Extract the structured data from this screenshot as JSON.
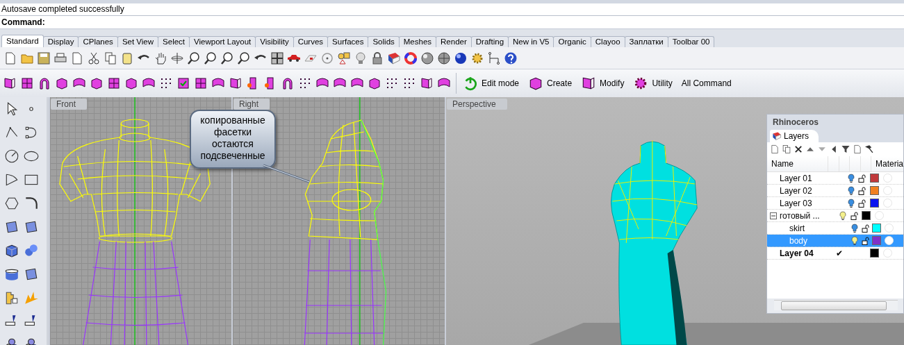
{
  "status": {
    "message": "Autosave completed successfully",
    "command_label": "Command:"
  },
  "tabs": [
    {
      "label": "Standard",
      "selected": true
    },
    {
      "label": "Display",
      "selected": false
    },
    {
      "label": "CPlanes",
      "selected": false
    },
    {
      "label": "Set View",
      "selected": false
    },
    {
      "label": "Select",
      "selected": false
    },
    {
      "label": "Viewport Layout",
      "selected": false
    },
    {
      "label": "Visibility",
      "selected": false
    },
    {
      "label": "Curves",
      "selected": false
    },
    {
      "label": "Surfaces",
      "selected": false
    },
    {
      "label": "Solids",
      "selected": false
    },
    {
      "label": "Meshes",
      "selected": false
    },
    {
      "label": "Render",
      "selected": false
    },
    {
      "label": "Drafting",
      "selected": false
    },
    {
      "label": "New in V5",
      "selected": false
    },
    {
      "label": "Organic",
      "selected": false
    },
    {
      "label": "Clayoo",
      "selected": false
    },
    {
      "label": "Заплатки",
      "selected": false
    },
    {
      "label": "Toolbar 00",
      "selected": false
    }
  ],
  "toolbar_buttons": [
    {
      "label": "Edit mode",
      "kind": "power"
    },
    {
      "label": "Create",
      "kind": "cube"
    },
    {
      "label": "Modify",
      "kind": "surface"
    },
    {
      "label": "Utility",
      "kind": "gear"
    },
    {
      "label": "All Command",
      "kind": "text"
    }
  ],
  "viewports": [
    {
      "title": "Front"
    },
    {
      "title": "Right"
    },
    {
      "title": "Perspective"
    }
  ],
  "callout": {
    "text": "копированные фасетки остаются подсвеченные"
  },
  "layers_panel": {
    "title": "Rhinoceros",
    "tab": "Layers",
    "columns": [
      "Name",
      "Materia"
    ],
    "layers": [
      {
        "name": "Layer 01",
        "kind": "layer",
        "lit": false,
        "locked": false,
        "color": "#c0393b",
        "selected": false
      },
      {
        "name": "Layer 02",
        "kind": "layer",
        "lit": false,
        "locked": false,
        "color": "#f08020",
        "selected": false
      },
      {
        "name": "Layer 03",
        "kind": "layer",
        "lit": false,
        "locked": false,
        "color": "#0a14f0",
        "selected": false
      },
      {
        "name": "готовый ...",
        "kind": "group",
        "expanded": true,
        "lit": true,
        "locked": false,
        "color": "#000000",
        "selected": false,
        "children": [
          {
            "name": "skirt",
            "kind": "layer",
            "lit": false,
            "locked": false,
            "color": "#00ffff",
            "selected": false
          },
          {
            "name": "body",
            "kind": "layer",
            "lit": true,
            "locked": false,
            "color": "#8030c8",
            "selected": true
          }
        ]
      },
      {
        "name": "Layer 04",
        "kind": "current",
        "marker": "✔",
        "color": "#000000",
        "selected": false
      }
    ]
  }
}
